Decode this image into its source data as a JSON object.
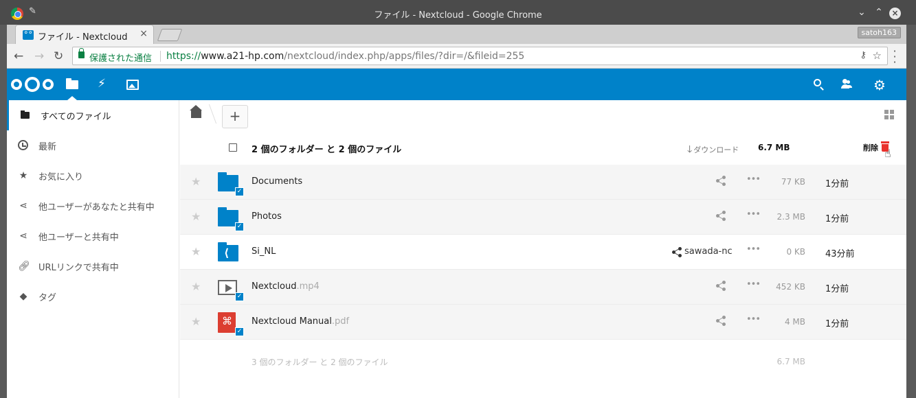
{
  "window": {
    "title": "ファイル - Nextcloud - Google Chrome",
    "user_badge": "satoh163"
  },
  "tab": {
    "title": "ファイル - Nextcloud",
    "close": "×"
  },
  "toolbar": {
    "secure_label": "保護された通信",
    "url_scheme": "https://",
    "url_host": "www.a21-hp.com",
    "url_path": "/nextcloud/index.php/apps/files/?dir=/&fileid=255"
  },
  "sidebar": {
    "items": [
      {
        "label": "すべてのファイル",
        "icon": "folder-icon",
        "active": true
      },
      {
        "label": "最新",
        "icon": "clock-icon"
      },
      {
        "label": "お気に入り",
        "icon": "star-icon"
      },
      {
        "label": "他ユーザーがあなたと共有中",
        "icon": "share-icon"
      },
      {
        "label": "他ユーザーと共有中",
        "icon": "share-icon"
      },
      {
        "label": "URLリンクで共有中",
        "icon": "link-icon"
      },
      {
        "label": "タグ",
        "icon": "tag-icon"
      }
    ]
  },
  "controls": {
    "new_label": "+"
  },
  "selection": {
    "summary": "2 個のフォルダー と 2 個のファイル",
    "download_label": "ダウンロード",
    "size": "6.7 MB",
    "delete_label": "削除"
  },
  "files": [
    {
      "name": "Documents",
      "ext": "",
      "type": "folder",
      "size": "77 KB",
      "date": "1分前",
      "selected": true,
      "share_owner": ""
    },
    {
      "name": "Photos",
      "ext": "",
      "type": "folder",
      "size": "2.3 MB",
      "date": "1分前",
      "selected": true,
      "share_owner": ""
    },
    {
      "name": "Si_NL",
      "ext": "",
      "type": "shared-folder",
      "size": "0 KB",
      "date": "43分前",
      "selected": false,
      "share_owner": "sawada-nc"
    },
    {
      "name": "Nextcloud",
      "ext": ".mp4",
      "type": "video",
      "size": "452 KB",
      "date": "1分前",
      "selected": true,
      "share_owner": ""
    },
    {
      "name": "Nextcloud Manual",
      "ext": ".pdf",
      "type": "pdf",
      "size": "4 MB",
      "date": "1分前",
      "selected": true,
      "share_owner": ""
    }
  ],
  "footer": {
    "summary": "3 個のフォルダー と 2 個のファイル",
    "size": "6.7 MB"
  },
  "colors": {
    "brand": "#0082c9",
    "delete": "#e9322d",
    "secure": "#0b8043"
  }
}
